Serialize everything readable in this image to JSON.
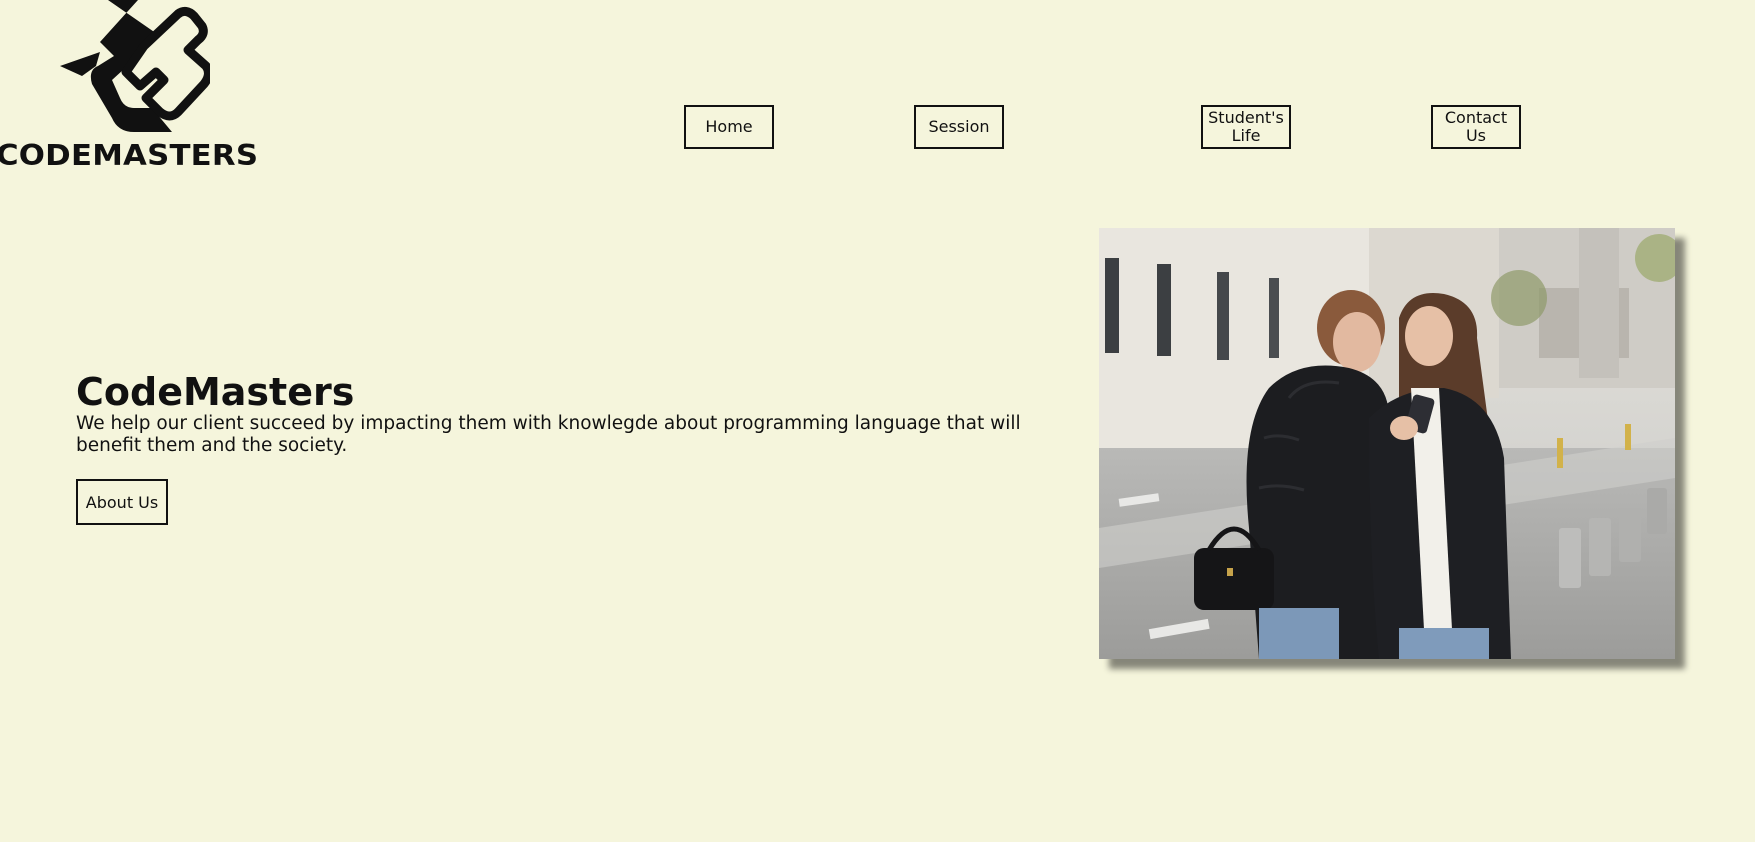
{
  "brand": {
    "logo_text": "CODEMASTERS"
  },
  "nav": {
    "items": [
      {
        "label": "Home"
      },
      {
        "label": "Session"
      },
      {
        "label": "Student's Life"
      },
      {
        "label": "Contact Us"
      }
    ]
  },
  "hero": {
    "title": "CodeMasters",
    "description": "We help our client succeed by impacting them with knowlegde about programming language that will benefit them and the society.",
    "cta_label": "About Us"
  },
  "colors": {
    "background": "#f5f5dc",
    "text": "#111111",
    "border": "#111111"
  }
}
